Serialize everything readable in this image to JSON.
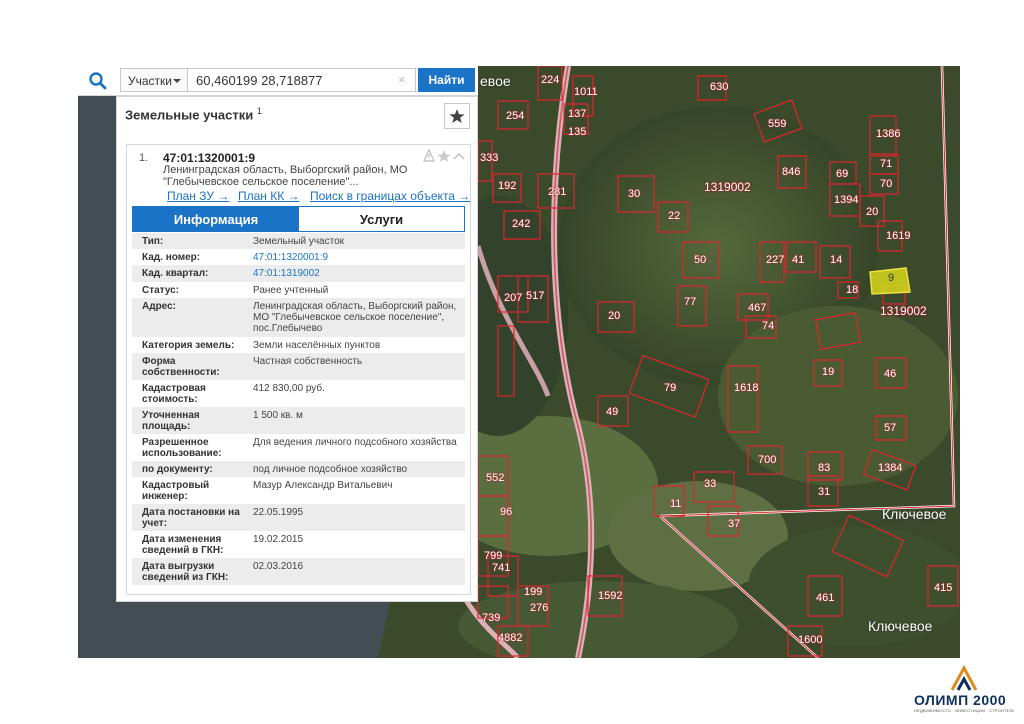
{
  "search": {
    "type_label": "Участки",
    "query": "60,460199 28,718877",
    "clear_symbol": "×",
    "button_label": "Найти"
  },
  "panel": {
    "title": "Земельные участки",
    "count": "1",
    "item": {
      "index": "1.",
      "cad_number": "47:01:1320001:9",
      "address": "Ленинградская область, Выборгский район, МО \"Глебычевское сельское поселение\"...",
      "links": [
        "План ЗУ →",
        "План КК →",
        "Поиск в границах объекта →"
      ],
      "tabs": [
        "Информация",
        "Услуги"
      ],
      "active_tab": "Информация",
      "attributes": [
        {
          "key": "Тип:",
          "value": "Земельный участок"
        },
        {
          "key": "Кад. номер:",
          "value": "47:01:1320001:9"
        },
        {
          "key": "Кад. квартал:",
          "value": "47:01:1319002"
        },
        {
          "key": "Статус:",
          "value": "Ранее учтенный"
        },
        {
          "key": "Адрес:",
          "value": "Ленинградская область, Выборгский район, МО \"Глебычевское сельское поселение\", пос.Глебычево"
        },
        {
          "key": "Категория земель:",
          "value": "Земли населённых пунктов"
        },
        {
          "key": "Форма собственности:",
          "value": "Частная собственность"
        },
        {
          "key": "Кадастровая стоимость:",
          "value": "412 830,00 руб."
        },
        {
          "key": "Уточненная площадь:",
          "value": "1 500 кв. м"
        },
        {
          "key": "Разрешенное использование:",
          "value": "Для ведения личного подсобного хозяйства"
        },
        {
          "key": "по документу:",
          "value": "под личное подсобное хозяйство"
        },
        {
          "key": "Кадастровый инженер:",
          "value": "Мазур Александр Витальевич"
        },
        {
          "key": "Дата постановки на учет:",
          "value": "22.05.1995"
        },
        {
          "key": "Дата изменения сведений в ГКН:",
          "value": "19.02.2015"
        },
        {
          "key": "Дата выгрузки сведений из ГКН:",
          "value": "02.03.2016"
        }
      ]
    }
  },
  "map": {
    "plot_labels": [
      "630",
      "254",
      "559",
      "1386",
      "224",
      "1011",
      "137",
      "135",
      "333",
      "846",
      "69",
      "71",
      "70",
      "1394",
      "192",
      "281",
      "30",
      "22",
      "1319002",
      "20",
      "1619",
      "242",
      "517",
      "41",
      "14",
      "227",
      "50",
      "9",
      "18",
      "1319002",
      "20",
      "77",
      "467",
      "74",
      "1618",
      "19",
      "46",
      "57",
      "49",
      "79",
      "1384",
      "700",
      "83",
      "33",
      "31",
      "11",
      "37",
      "1592",
      "799",
      "741",
      "199",
      "276",
      "739",
      "4882",
      "461",
      "1600",
      "415",
      "552",
      "207",
      "96"
    ],
    "village_labels": [
      "Ключевое",
      "Ключевое",
      "евое"
    ],
    "selected_plot_label": "9"
  },
  "logo": {
    "name": "ОЛИМП 2000",
    "tagline": "НЕДВИЖИМОСТЬ · ИНВЕСТИЦИИ · СТРОИТЕЛЬСТВО"
  },
  "colors": {
    "accent": "#1a73c6",
    "boundary": "#e0242f",
    "selected_fill": "#d8d81c"
  }
}
